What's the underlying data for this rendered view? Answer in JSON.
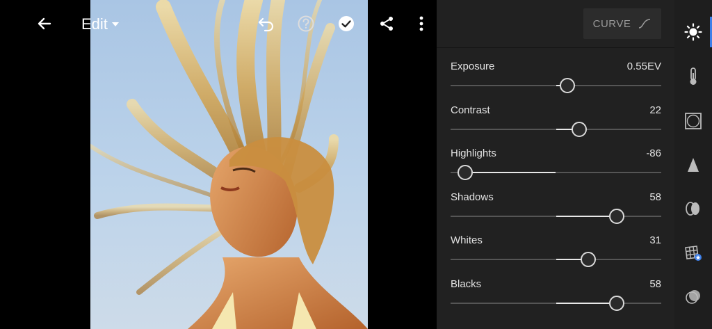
{
  "header": {
    "edit_label": "Edit"
  },
  "image": {
    "description": "photo"
  },
  "curve": {
    "label": "CURVE"
  },
  "sliders": [
    {
      "label": "Exposure",
      "value": "0.55EV",
      "position": 0.556
    },
    {
      "label": "Contrast",
      "value": "22",
      "position": 0.61
    },
    {
      "label": "Highlights",
      "value": "-86",
      "position": 0.07
    },
    {
      "label": "Shadows",
      "value": "58",
      "position": 0.79
    },
    {
      "label": "Whites",
      "value": "31",
      "position": 0.655
    },
    {
      "label": "Blacks",
      "value": "58",
      "position": 0.79
    }
  ],
  "tools": [
    {
      "name": "light-icon",
      "active": true
    },
    {
      "name": "color-temperature-icon"
    },
    {
      "name": "vignette-icon"
    },
    {
      "name": "sharpen-icon"
    },
    {
      "name": "lens-icon"
    },
    {
      "name": "profile-grid-icon"
    },
    {
      "name": "mask-icon"
    }
  ],
  "colors": {
    "accent": "#3d7fe8",
    "panel": "#212121",
    "sky": "#b4cce6"
  }
}
